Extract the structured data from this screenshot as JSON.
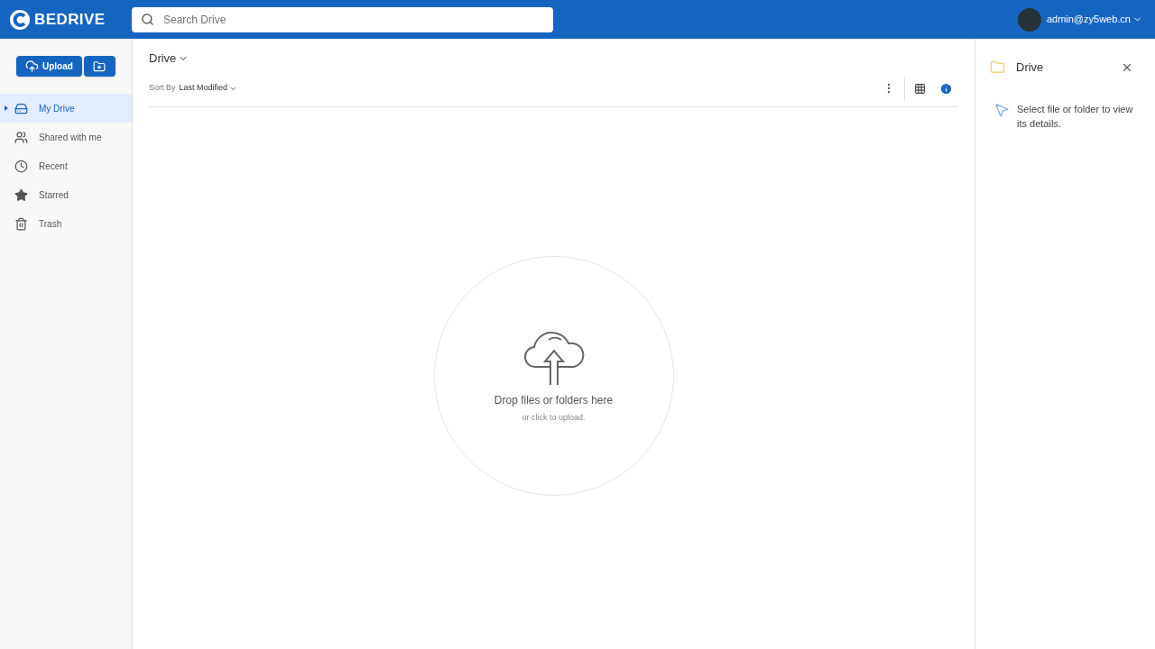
{
  "header": {
    "logo": "BEDRIVE",
    "search": {
      "placeholder": "Search Drive"
    },
    "user": "admin@zy5web.cn"
  },
  "sidebar": {
    "upload_button": "Upload",
    "items": [
      {
        "kind": "drive",
        "label": "My Drive",
        "selected": true
      },
      {
        "kind": "shared",
        "label": "Shared with me",
        "selected": false
      },
      {
        "kind": "recent",
        "label": "Recent",
        "selected": false
      },
      {
        "kind": "starred",
        "label": "Starred",
        "selected": false
      },
      {
        "kind": "trash",
        "label": "Trash",
        "selected": false
      }
    ]
  },
  "main": {
    "breadcrumb": "Drive",
    "sort_label": "Sort By",
    "sort_value": "Last Modified",
    "info_active": true,
    "dropzone": {
      "title": "Drop files or folders here",
      "subtitle": "or click to upload."
    }
  },
  "details": {
    "title": "Drive",
    "message": "Select file or folder to view its details."
  }
}
